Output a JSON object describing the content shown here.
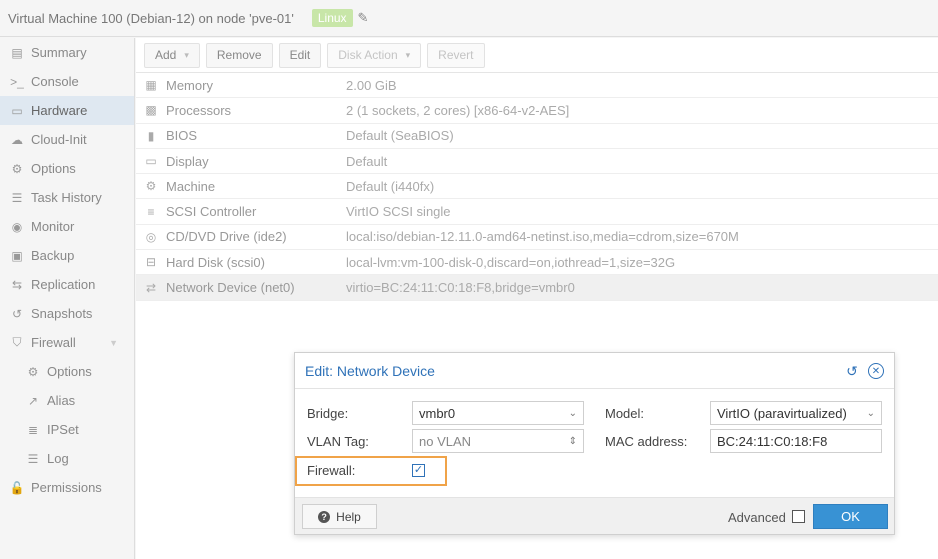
{
  "header": {
    "vm_title": "Virtual Machine 100 (Debian-12) on node 'pve-01'",
    "os_tag": "Linux",
    "edit_icon": "pencil-icon"
  },
  "sidebar": {
    "items": [
      {
        "label": "Summary",
        "icon": "summary-icon",
        "glyph": "▤"
      },
      {
        "label": "Console",
        "icon": "terminal-icon",
        "glyph": ">_"
      },
      {
        "label": "Hardware",
        "icon": "monitor-icon",
        "glyph": "▭",
        "active": true
      },
      {
        "label": "Cloud-Init",
        "icon": "cloud-icon",
        "glyph": "☁"
      },
      {
        "label": "Options",
        "icon": "gear-icon",
        "glyph": "⚙"
      },
      {
        "label": "Task History",
        "icon": "list-icon",
        "glyph": "☰"
      },
      {
        "label": "Monitor",
        "icon": "eye-icon",
        "glyph": "◉"
      },
      {
        "label": "Backup",
        "icon": "floppy-icon",
        "glyph": "▣"
      },
      {
        "label": "Replication",
        "icon": "retweet-icon",
        "glyph": "⇆"
      },
      {
        "label": "Snapshots",
        "icon": "history-icon",
        "glyph": "↺"
      },
      {
        "label": "Firewall",
        "icon": "shield-icon",
        "glyph": "⛉"
      },
      {
        "label": "Options",
        "icon": "gear-icon",
        "glyph": "⚙",
        "sub": true
      },
      {
        "label": "Alias",
        "icon": "external-link-icon",
        "glyph": "↗",
        "sub": true
      },
      {
        "label": "IPSet",
        "icon": "list-ol-icon",
        "glyph": "≣",
        "sub": true
      },
      {
        "label": "Log",
        "icon": "list-icon",
        "glyph": "☰",
        "sub": true
      },
      {
        "label": "Permissions",
        "icon": "unlock-icon",
        "glyph": "🔓"
      }
    ]
  },
  "toolbar": {
    "add": "Add",
    "remove": "Remove",
    "edit": "Edit",
    "disk_action": "Disk Action",
    "revert": "Revert"
  },
  "hardware": {
    "rows": [
      {
        "name": "Memory",
        "value": "2.00 GiB",
        "icon": "memory-icon",
        "glyph": "▦"
      },
      {
        "name": "Processors",
        "value": "2 (1 sockets, 2 cores) [x86-64-v2-AES]",
        "icon": "cpu-icon",
        "glyph": "▩"
      },
      {
        "name": "BIOS",
        "value": "Default (SeaBIOS)",
        "icon": "chip-icon",
        "glyph": "▮"
      },
      {
        "name": "Display",
        "value": "Default",
        "icon": "desktop-icon",
        "glyph": "▭"
      },
      {
        "name": "Machine",
        "value": "Default (i440fx)",
        "icon": "cogs-icon",
        "glyph": "⚙"
      },
      {
        "name": "SCSI Controller",
        "value": "VirtIO SCSI single",
        "icon": "database-icon",
        "glyph": "≡"
      },
      {
        "name": "CD/DVD Drive (ide2)",
        "value": "local:iso/debian-12.11.0-amd64-netinst.iso,media=cdrom,size=670M",
        "icon": "cdrom-icon",
        "glyph": "◎"
      },
      {
        "name": "Hard Disk (scsi0)",
        "value": "local-lvm:vm-100-disk-0,discard=on,iothread=1,size=32G",
        "icon": "hdd-icon",
        "glyph": "⊟"
      },
      {
        "name": "Network Device (net0)",
        "value": "virtio=BC:24:11:C0:18:F8,bridge=vmbr0",
        "icon": "exchange-icon",
        "glyph": "⇄",
        "selected": true
      }
    ]
  },
  "dialog": {
    "title": "Edit: Network Device",
    "bridge_label": "Bridge:",
    "bridge_value": "vmbr0",
    "vlan_label": "VLAN Tag:",
    "vlan_value": "no VLAN",
    "firewall_label": "Firewall:",
    "firewall_checked": true,
    "model_label": "Model:",
    "model_value": "VirtIO (paravirtualized)",
    "mac_label": "MAC address:",
    "mac_value": "BC:24:11:C0:18:F8",
    "help_label": "Help",
    "advanced_label": "Advanced",
    "advanced_checked": false,
    "ok_label": "OK"
  },
  "colors": {
    "accent": "#2f72b8",
    "highlight": "#f0a348",
    "ok_button": "#3892d4",
    "os_tag": "#c8e6a8"
  }
}
